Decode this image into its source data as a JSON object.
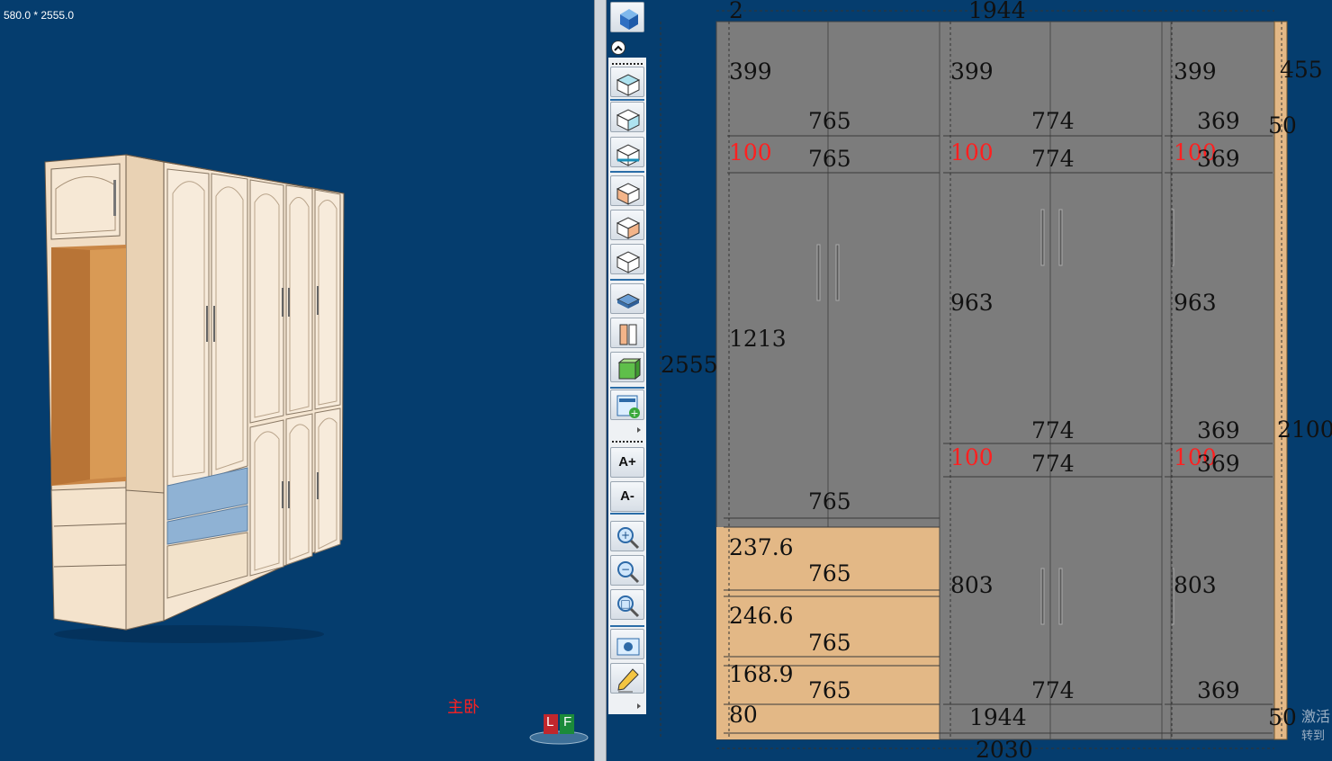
{
  "viewport": {
    "dimensions_label": "580.0 * 2555.0",
    "room_label": "主卧",
    "logo_letters": [
      "L",
      "F"
    ]
  },
  "toolbar": {
    "buttons": [
      {
        "name": "view-cube-icon"
      },
      {
        "name": "collapse-up-icon"
      },
      {
        "name": "show-top-panels-icon"
      },
      {
        "name": "show-middle-panels-icon"
      },
      {
        "name": "show-bottom-panels-icon"
      },
      {
        "name": "show-left-side-icon"
      },
      {
        "name": "show-right-side-icon"
      },
      {
        "name": "show-back-panel-icon"
      },
      {
        "name": "shelf-view-icon"
      },
      {
        "name": "door-view-icon"
      },
      {
        "name": "solid-view-icon"
      },
      {
        "name": "add-layout-icon"
      },
      {
        "name": "font-larger-button",
        "label": "A+"
      },
      {
        "name": "font-smaller-button",
        "label": "A-"
      },
      {
        "name": "zoom-in-icon"
      },
      {
        "name": "zoom-out-icon"
      },
      {
        "name": "zoom-fit-icon"
      },
      {
        "name": "screenshot-icon"
      },
      {
        "name": "edit-pencil-icon"
      }
    ]
  },
  "elevation": {
    "labels": {
      "top_2": "2",
      "top_1944": "1944",
      "total_height": "2555",
      "bottom_2030": "2030",
      "bottom_1944": "1944",
      "bottom_50": "50",
      "right_455": "455",
      "right_50": "50",
      "right_2100": "2100",
      "col1_top_h": "399",
      "col2_top_h": "399",
      "col3_top_h": "399",
      "col1_w_a": "765",
      "col2_w_a": "774",
      "col3_w_a": "369",
      "col1_gap": "100",
      "col2_gap": "100",
      "col3_gap": "100",
      "col1_w_b": "765",
      "col2_w_b": "774",
      "col3_w_b": "369",
      "col1_main_h": "1213",
      "col2_main_h": "963",
      "col3_main_h": "963",
      "col2_w_c": "774",
      "col3_w_c": "369",
      "col2_gap2": "100",
      "col3_gap2": "100",
      "col2_w_d": "774",
      "col3_w_d": "369",
      "col1_w_c": "765",
      "drawer1_h": "237.6",
      "drawer1_w": "765",
      "drawer2_h": "246.6",
      "drawer2_w": "765",
      "drawer3_h": "168.9",
      "drawer3_w": "765",
      "plinth_h": "80",
      "col2_low_h": "803",
      "col3_low_h": "803",
      "col2_w_e": "774",
      "col3_w_e": "369"
    }
  },
  "watermark": {
    "line1": "激活",
    "line2": "转到"
  },
  "colors": {
    "background": "#053d6e",
    "panel_gray": "#7c7c7c",
    "drawer_wood": "#e3b886",
    "gap_red": "#ff2020"
  }
}
